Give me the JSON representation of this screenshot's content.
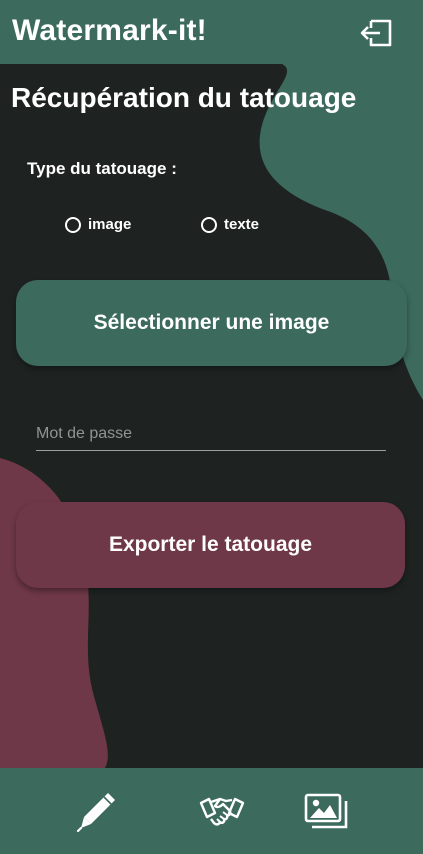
{
  "app_bar": {
    "title": "Watermark-it!",
    "logout_icon": "logout-icon"
  },
  "page": {
    "title": "Récupération du tatouage",
    "type_label": "Type du tatouage :",
    "options": [
      {
        "label": "image",
        "selected": false
      },
      {
        "label": "texte",
        "selected": false
      }
    ],
    "select_image_button": "Sélectionner une image",
    "password": {
      "placeholder": "Mot de passe",
      "value": ""
    },
    "export_button": "Exporter le tatouage"
  },
  "bottom_nav": {
    "items": [
      {
        "icon": "pen-icon"
      },
      {
        "icon": "handshake-icon"
      },
      {
        "icon": "images-icon"
      }
    ]
  },
  "colors": {
    "primary": "#3c6a5c",
    "accent": "#6e3848",
    "background": "#1e2322",
    "text": "#ffffff"
  }
}
